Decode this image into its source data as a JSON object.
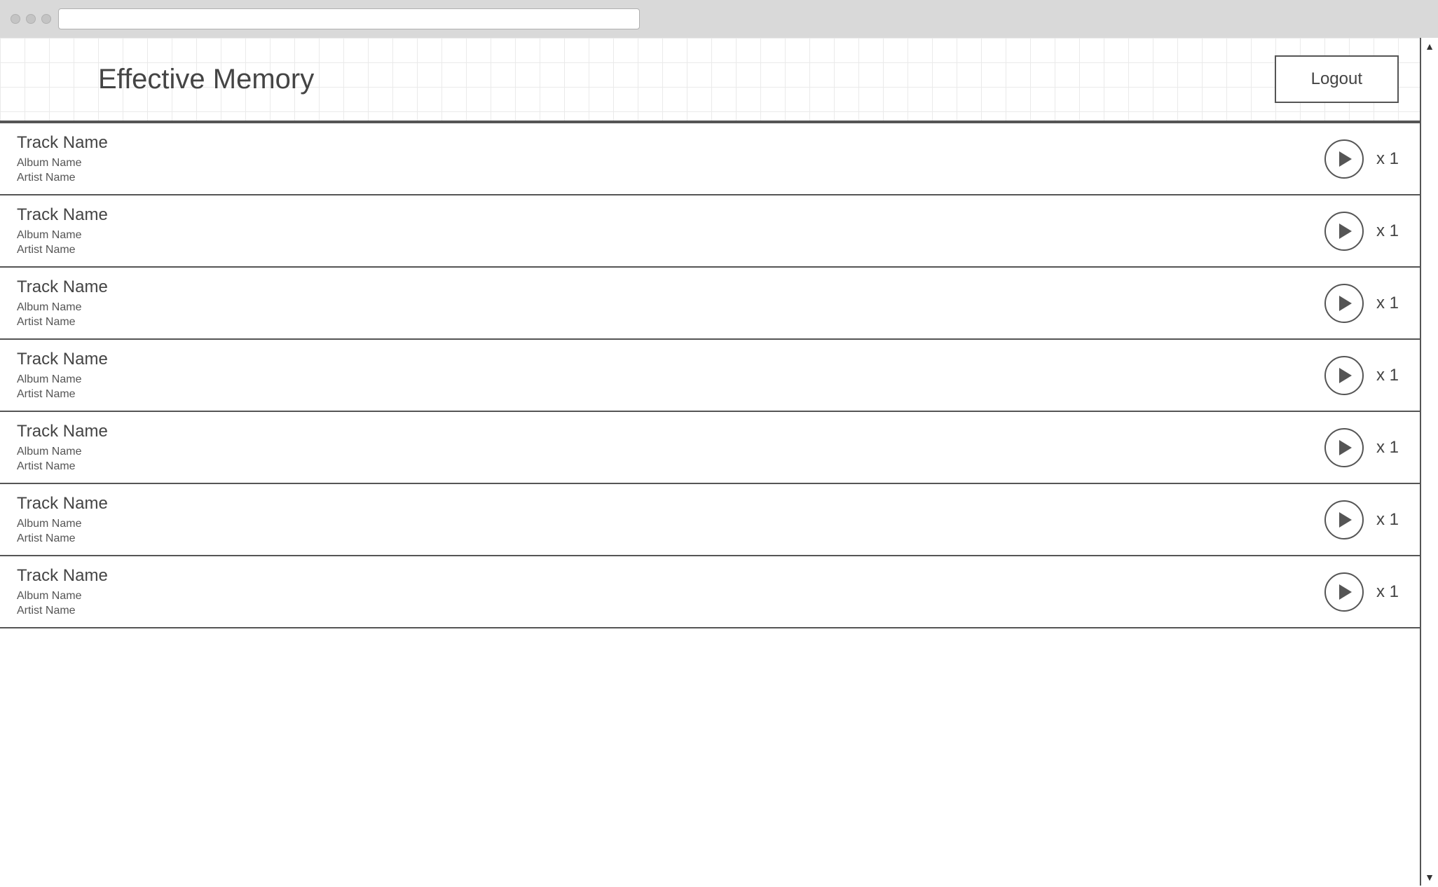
{
  "header": {
    "title": "Effective Memory",
    "logout_label": "Logout"
  },
  "tracks": [
    {
      "track_name": "Track Name",
      "album_name": "Album Name",
      "artist_name": "Artist Name",
      "play_count": "x 1"
    },
    {
      "track_name": "Track Name",
      "album_name": "Album Name",
      "artist_name": "Artist Name",
      "play_count": "x 1"
    },
    {
      "track_name": "Track Name",
      "album_name": "Album Name",
      "artist_name": "Artist Name",
      "play_count": "x 1"
    },
    {
      "track_name": "Track Name",
      "album_name": "Album Name",
      "artist_name": "Artist Name",
      "play_count": "x 1"
    },
    {
      "track_name": "Track Name",
      "album_name": "Album Name",
      "artist_name": "Artist Name",
      "play_count": "x 1"
    },
    {
      "track_name": "Track Name",
      "album_name": "Album Name",
      "artist_name": "Artist Name",
      "play_count": "x 1"
    },
    {
      "track_name": "Track Name",
      "album_name": "Album Name",
      "artist_name": "Artist Name",
      "play_count": "x 1"
    }
  ],
  "scrollbar": {
    "up_arrow": "▲",
    "down_arrow": "▼"
  }
}
